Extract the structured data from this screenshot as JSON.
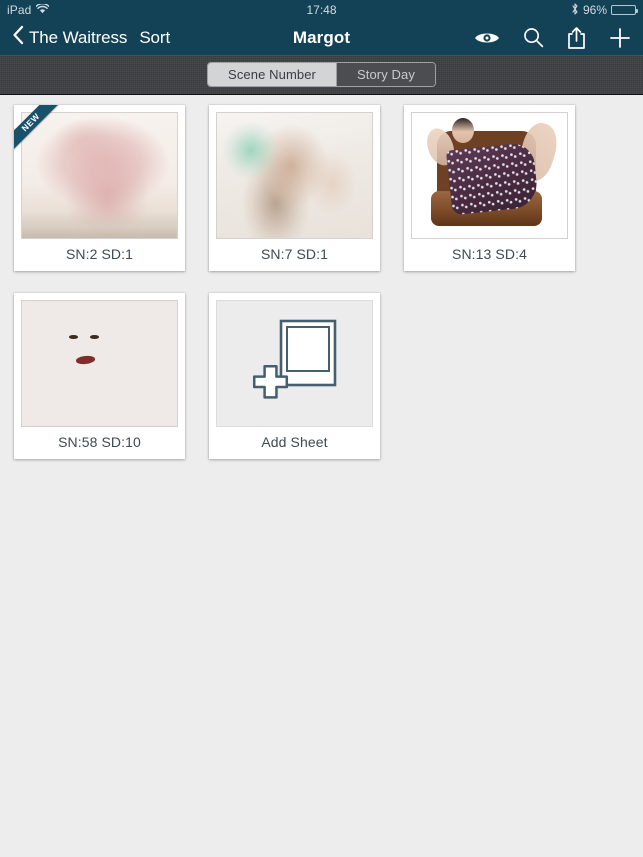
{
  "status_bar": {
    "device": "iPad",
    "wifi_icon": "wifi-icon",
    "time": "17:48",
    "bluetooth_icon": "bluetooth-icon",
    "battery_percent": "96%",
    "battery_level": 96
  },
  "nav_bar": {
    "back_label": "The Waitress",
    "back_icon": "chevron-left-icon",
    "sort_label": "Sort",
    "title": "Margot",
    "actions": [
      {
        "name": "eye-icon",
        "label": "Preview"
      },
      {
        "name": "search-icon",
        "label": "Search"
      },
      {
        "name": "share-icon",
        "label": "Share"
      },
      {
        "name": "plus-icon",
        "label": "Add"
      }
    ]
  },
  "sort_bar": {
    "segments": [
      {
        "label": "Scene Number",
        "selected": true
      },
      {
        "label": "Story Day",
        "selected": false
      }
    ]
  },
  "grid": {
    "cards": [
      {
        "label": "SN:2 SD:1",
        "badge": "NEW",
        "art": "art-dress"
      },
      {
        "label": "SN:7 SD:1",
        "badge": null,
        "art": "art-portrait"
      },
      {
        "label": "SN:13 SD:4",
        "badge": null,
        "art": "art-chair"
      },
      {
        "label": "SN:58 SD:10",
        "badge": null,
        "art": "art-fur"
      }
    ],
    "add_card": {
      "label": "Add Sheet",
      "icon": "add-sheet-icon"
    }
  },
  "colors": {
    "nav_background": "#134156",
    "sort_bar_background": "#3c3e42",
    "page_background": "#ededed",
    "card_background": "#ffffff",
    "label_text": "#3d4a52",
    "ribbon": "#19516b",
    "icon_outline": "#44606f"
  }
}
